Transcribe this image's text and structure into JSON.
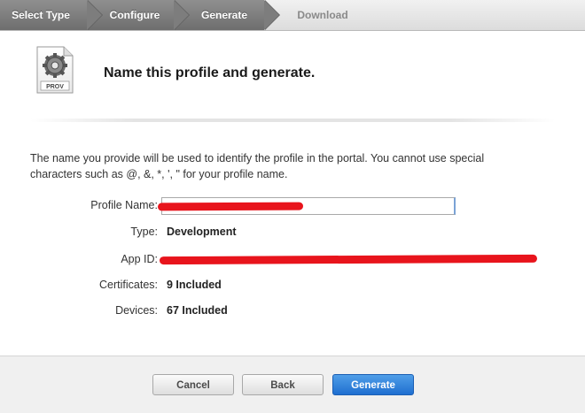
{
  "steps": [
    {
      "label": "Select Type",
      "state": "done"
    },
    {
      "label": "Configure",
      "state": "done"
    },
    {
      "label": "Generate",
      "state": "current"
    },
    {
      "label": "Download",
      "state": "pending"
    }
  ],
  "header": {
    "icon_label": "PROV",
    "icon_name": "provisioning-profile-gear-icon",
    "title": "Name this profile and generate."
  },
  "description": "The name you provide will be used to identify the profile in the portal. You cannot use special characters such as @, &, *, ', \" for your profile name.",
  "form": {
    "profile_name": {
      "label": "Profile Name:",
      "value": ""
    },
    "type": {
      "label": "Type:",
      "value": "Development"
    },
    "app_id": {
      "label": "App ID:",
      "value": ""
    },
    "certificates": {
      "label": "Certificates:",
      "value": "9 Included"
    },
    "devices": {
      "label": "Devices:",
      "value": "67 Included"
    }
  },
  "buttons": {
    "cancel": "Cancel",
    "back": "Back",
    "generate": "Generate"
  },
  "colors": {
    "primary_button": "#2a7ad9",
    "redaction": "#e8141c"
  }
}
